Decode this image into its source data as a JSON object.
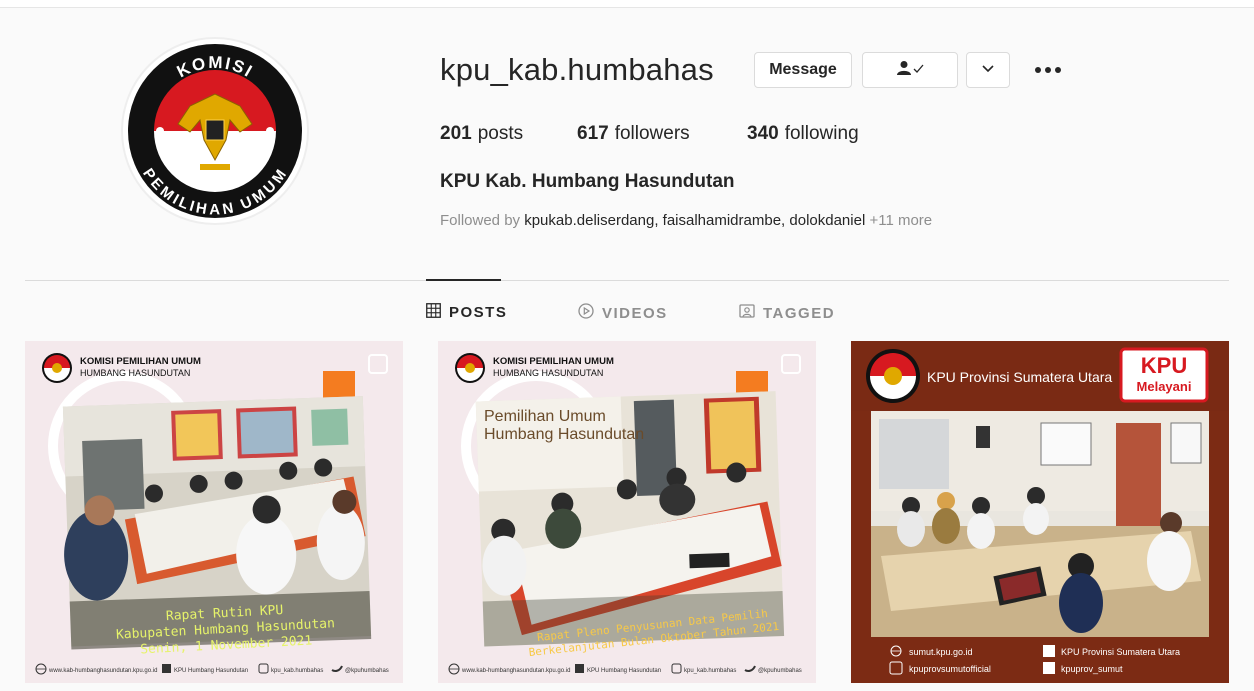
{
  "profile": {
    "username": "kpu_kab.humbahas",
    "message_label": "Message",
    "full_name": "KPU Kab. Humbang Hasundutan",
    "avatar": {
      "top_text": "KOMISI",
      "bottom_text": "PEMILIHAN UMUM"
    },
    "stats": {
      "posts_count": "201",
      "posts_label": "posts",
      "followers_count": "617",
      "followers_label": "followers",
      "following_count": "340",
      "following_label": "following"
    },
    "followed_by": {
      "prefix": "Followed by",
      "names": [
        "kpukab.deliserdang",
        "faisalhamidrambe",
        "dolokdaniel"
      ],
      "more": "+11 more"
    }
  },
  "tabs": {
    "posts": "POSTS",
    "videos": "VIDEOS",
    "tagged": "TAGGED"
  },
  "posts": [
    {
      "org_line1": "KOMISI PEMILIHAN UMUM",
      "org_line2": "HUMBANG HASUNDUTAN",
      "caption_line1": "Rapat Rutin KPU",
      "caption_line2": "Kabupaten Humbang Hasundutan",
      "caption_line3": "Senin, 1 November 2021",
      "footer_site": "www.kab-humbanghasundutan.kpu.go.id",
      "footer_fb": "KPU Humbang Hasundutan",
      "footer_ig": "kpu_kab.humbahas",
      "footer_tw": "@kpuhumbahas"
    },
    {
      "org_line1": "KOMISI PEMILIHAN UMUM",
      "org_line2": "HUMBANG HASUNDUTAN",
      "banner_line1": "Pemilihan Umum",
      "banner_line2": "Humbang Hasundutan",
      "caption_line1": "Rapat Pleno Penyusunan Data Pemilih",
      "caption_line2": "Berkelanjutan Bulan Oktober Tahun 2021",
      "footer_site": "www.kab-humbanghasundutan.kpu.go.id",
      "footer_fb": "KPU Humbang Hasundutan",
      "footer_ig": "kpu_kab.humbahas",
      "footer_tw": "@kpuhumbahas"
    },
    {
      "title": "KPU Provinsi Sumatera Utara",
      "badge_line1": "KPU",
      "badge_line2": "Melayani",
      "footer_site": "sumut.kpu.go.id",
      "footer_fb": "KPU Provinsi Sumatera Utara",
      "footer_ig": "kpuprovsumutofficial",
      "footer_tw": "kpuprov_sumut"
    }
  ]
}
